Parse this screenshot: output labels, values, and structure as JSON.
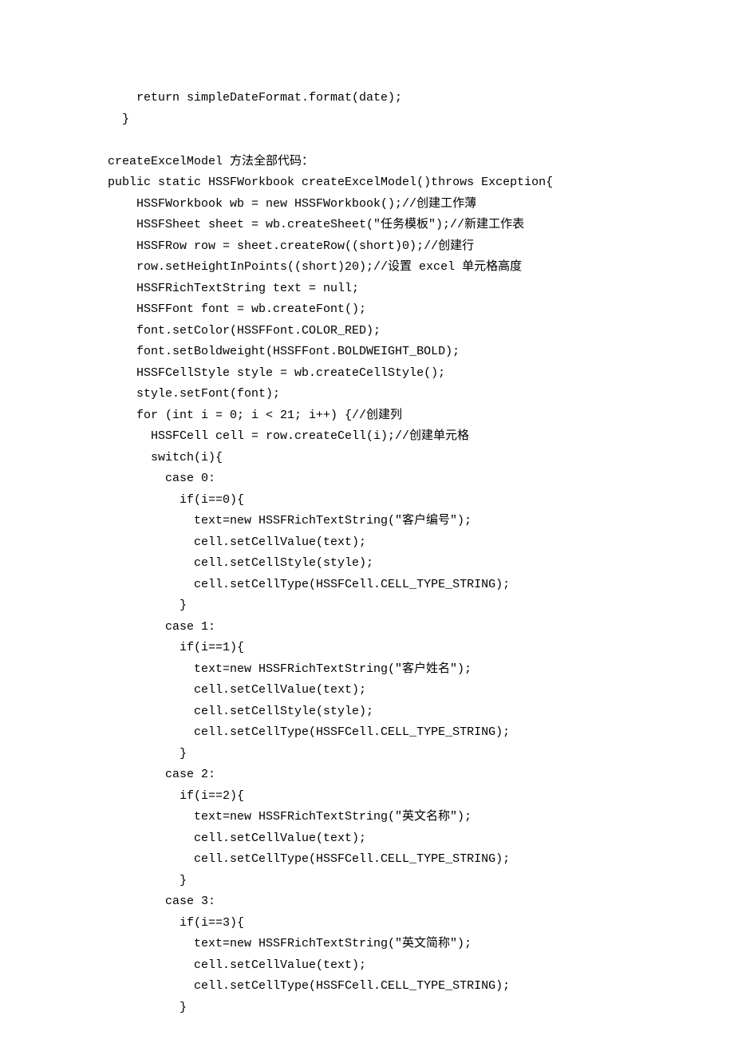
{
  "lines": [
    "    return simpleDateFormat.format(date);",
    "  }",
    "",
    "createExcelModel 方法全部代码：",
    "public static HSSFWorkbook createExcelModel()throws Exception{",
    "    HSSFWorkbook wb = new HSSFWorkbook();//创建工作薄",
    "    HSSFSheet sheet = wb.createSheet(\"任务模板\");//新建工作表",
    "    HSSFRow row = sheet.createRow((short)0);//创建行",
    "    row.setHeightInPoints((short)20);//设置 excel 单元格高度",
    "    HSSFRichTextString text = null;",
    "    HSSFFont font = wb.createFont();",
    "    font.setColor(HSSFFont.COLOR_RED);",
    "    font.setBoldweight(HSSFFont.BOLDWEIGHT_BOLD);",
    "    HSSFCellStyle style = wb.createCellStyle();",
    "    style.setFont(font);",
    "    for (int i = 0; i < 21; i++) {//创建列",
    "      HSSFCell cell = row.createCell(i);//创建单元格",
    "      switch(i){",
    "        case 0:",
    "          if(i==0){",
    "            text=new HSSFRichTextString(\"客户编号\");",
    "            cell.setCellValue(text);",
    "            cell.setCellStyle(style);",
    "            cell.setCellType(HSSFCell.CELL_TYPE_STRING);",
    "          }",
    "        case 1:",
    "          if(i==1){",
    "            text=new HSSFRichTextString(\"客户姓名\");",
    "            cell.setCellValue(text);",
    "            cell.setCellStyle(style);",
    "            cell.setCellType(HSSFCell.CELL_TYPE_STRING);",
    "          }",
    "        case 2:",
    "          if(i==2){",
    "            text=new HSSFRichTextString(\"英文名称\");",
    "            cell.setCellValue(text);",
    "            cell.setCellType(HSSFCell.CELL_TYPE_STRING);",
    "          }",
    "        case 3:",
    "          if(i==3){",
    "            text=new HSSFRichTextString(\"英文简称\");",
    "            cell.setCellValue(text);",
    "            cell.setCellType(HSSFCell.CELL_TYPE_STRING);",
    "          }"
  ]
}
